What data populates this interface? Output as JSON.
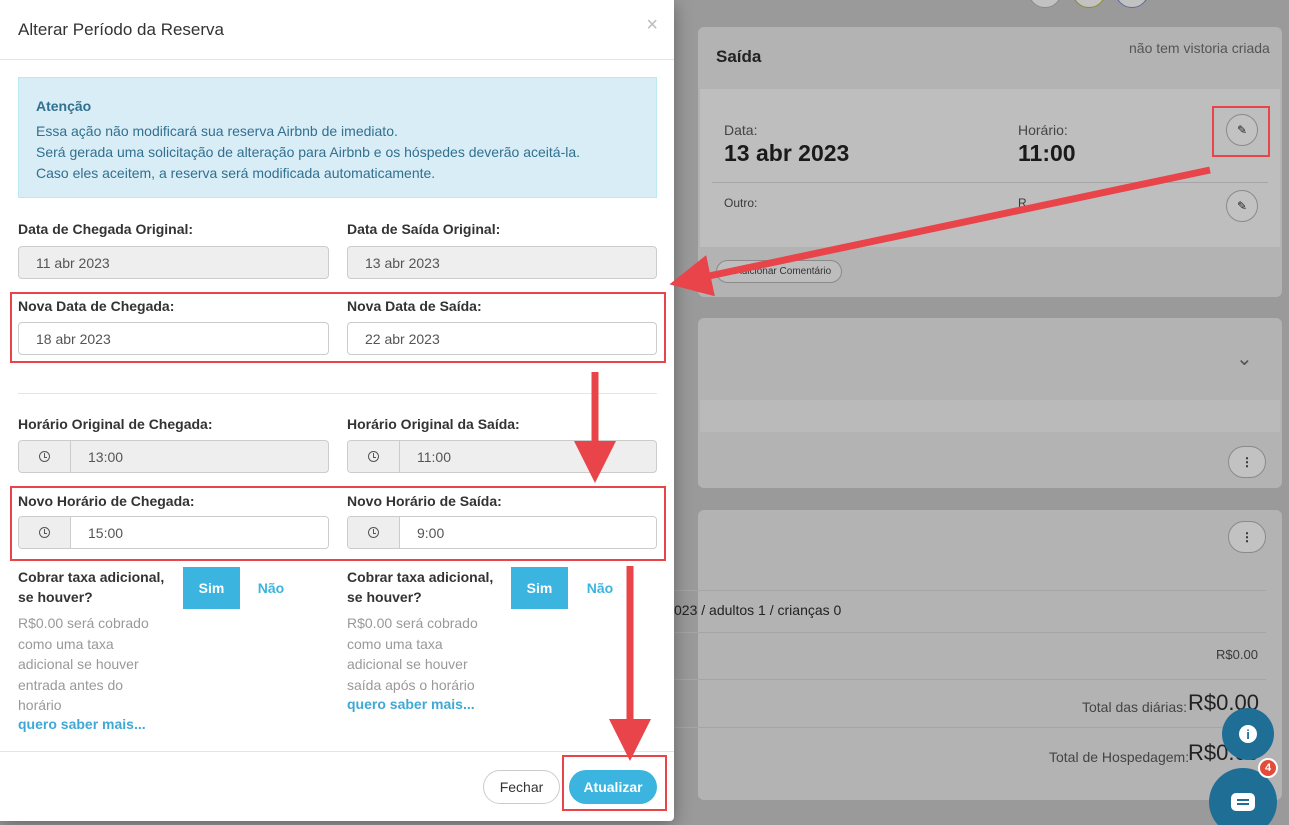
{
  "modal": {
    "title": "Alterar Período da Reserva",
    "close": "×",
    "alert": {
      "title": "Atenção",
      "line1": "Essa ação não modificará sua reserva Airbnb de imediato.",
      "line2": "Será gerada uma solicitação de alteração para Airbnb e os hóspedes deverão aceitá-la.",
      "line3": "Caso eles aceitem, a reserva será modificada automaticamente."
    },
    "original_checkin_label": "Data de Chegada Original:",
    "original_checkin_value": "11 abr 2023",
    "original_checkout_label": "Data de Saída Original:",
    "original_checkout_value": "13 abr 2023",
    "new_checkin_label": "Nova Data de Chegada:",
    "new_checkin_value": "18 abr 2023",
    "new_checkout_label": "Nova Data de Saída:",
    "new_checkout_value": "22 abr 2023",
    "orig_time_in_label": "Horário Original de Chegada:",
    "orig_time_in_value": "13:00",
    "orig_time_out_label": "Horário Original da Saída:",
    "orig_time_out_value": "11:00",
    "new_time_in_label": "Novo Horário de Chegada:",
    "new_time_in_value": "15:00",
    "new_time_out_label": "Novo Horário de Saída:",
    "new_time_out_value": "9:00",
    "fee_left": {
      "label": "Cobrar taxa adicional, se houver?",
      "sim": "Sim",
      "nao": "Não",
      "desc": "R$0.00 será cobrado como uma taxa adicional se houver entrada antes do horário",
      "link": "quero saber mais..."
    },
    "fee_right": {
      "label": "Cobrar taxa adicional, se houver?",
      "sim": "Sim",
      "nao": "Não",
      "desc": "R$0.00 será cobrado como uma taxa adicional se houver saída após o horário",
      "link": "quero saber mais..."
    },
    "footer": {
      "close_label": "Fechar",
      "update_label": "Atualizar"
    }
  },
  "background": {
    "section_title": "Saída",
    "vistoria": "não tem vistoria criada",
    "date_label": "Data:",
    "date_value": "13 abr 2023",
    "time_label": "Horário:",
    "time_value": "11:00",
    "other_label": "Outro:",
    "partial_label": "R",
    "comment_chip": "+ Adicionar Comentário",
    "booking_info": "023  /  adultos 1  /  crianças 0",
    "price_row": "R$0.00",
    "total_diarias_label": "Total das diárias:",
    "total_diarias_value": "R$0.00",
    "total_hosp_label": "Total de Hospedagem:",
    "total_hosp_value": "R$0.00",
    "chat_badge": "4"
  },
  "colors": {
    "accent": "#3bb5df",
    "annotation": "#e8444a",
    "alert_bg": "#d9edf7"
  }
}
